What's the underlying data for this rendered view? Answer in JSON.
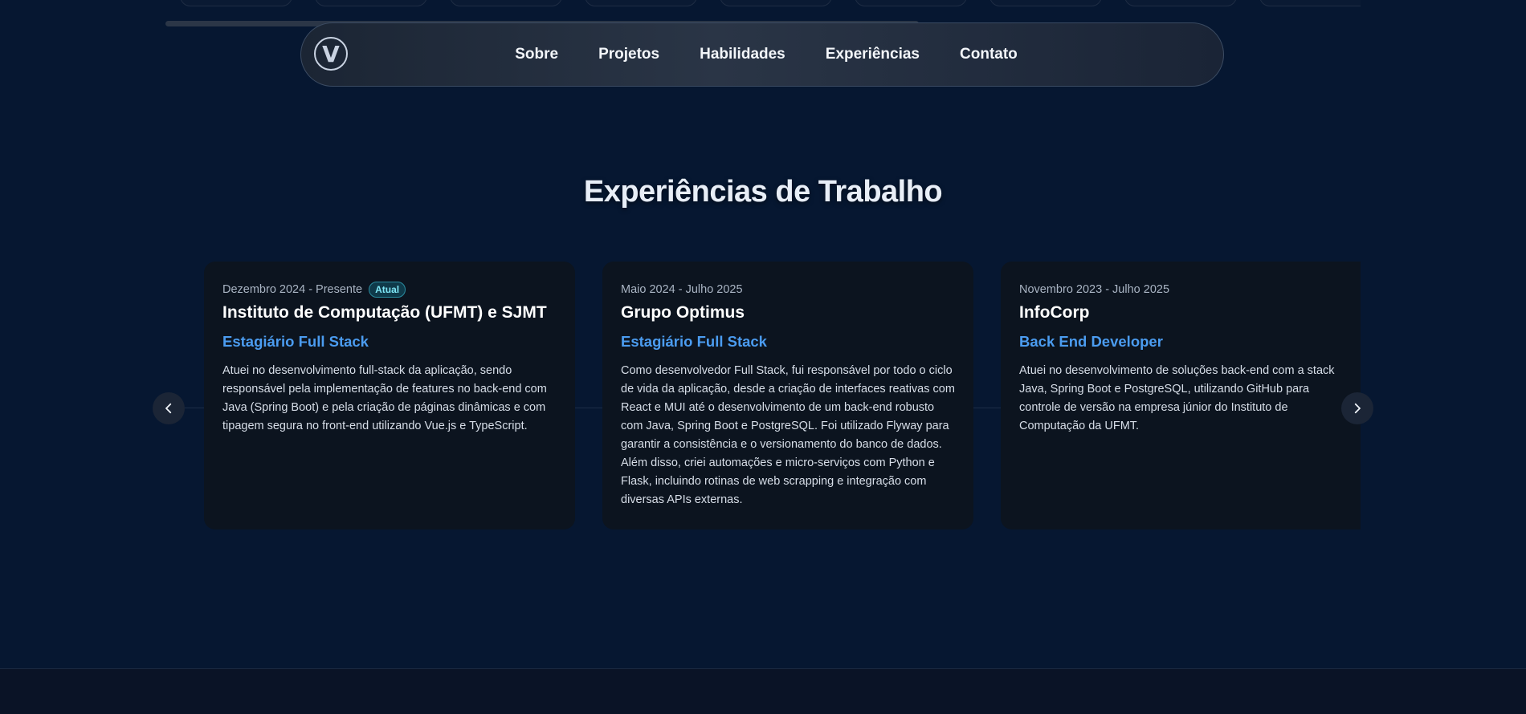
{
  "nav": {
    "logo_letter": "V",
    "links": [
      "Sobre",
      "Projetos",
      "Habilidades",
      "Experiências",
      "Contato"
    ]
  },
  "section": {
    "title": "Experiências de Trabalho"
  },
  "experiences": [
    {
      "date": "Dezembro 2024 - Presente",
      "badge": "Atual",
      "company": "Instituto de Computação (UFMT) e SJMT",
      "role": "Estagiário Full Stack",
      "description": "Atuei no desenvolvimento full-stack da aplicação, sendo responsável pela implementação de features no back-end com Java (Spring Boot) e pela criação de páginas dinâmicas e com tipagem segura no front-end utilizando Vue.js e TypeScript."
    },
    {
      "date": "Maio 2024 - Julho 2025",
      "badge": "",
      "company": "Grupo Optimus",
      "role": "Estagiário Full Stack",
      "description": "Como desenvolvedor Full Stack, fui responsável por todo o ciclo de vida da aplicação, desde a criação de interfaces reativas com React e MUI até o desenvolvimento de um back-end robusto com Java, Spring Boot e PostgreSQL. Foi utilizado Flyway para garantir a consistência e o versionamento do banco de dados. Além disso, criei automações e micro-serviços com Python e Flask, incluindo rotinas de web scrapping e integração com diversas APIs externas."
    },
    {
      "date": "Novembro 2023 - Julho 2025",
      "badge": "",
      "company": "InfoCorp",
      "role": "Back End Developer",
      "description": "Atuei no desenvolvimento de soluções back-end com a stack Java, Spring Boot e PostgreSQL, utilizando GitHub para controle de versão na empresa júnior do Instituto de Computação da UFMT."
    }
  ],
  "colors": {
    "background": "#061731",
    "card": "#0c141f",
    "accent": "#4b9cf0",
    "badge_text": "#7ee6f5"
  },
  "icons": {
    "prev": "chevron-left-icon",
    "next": "chevron-right-icon"
  }
}
